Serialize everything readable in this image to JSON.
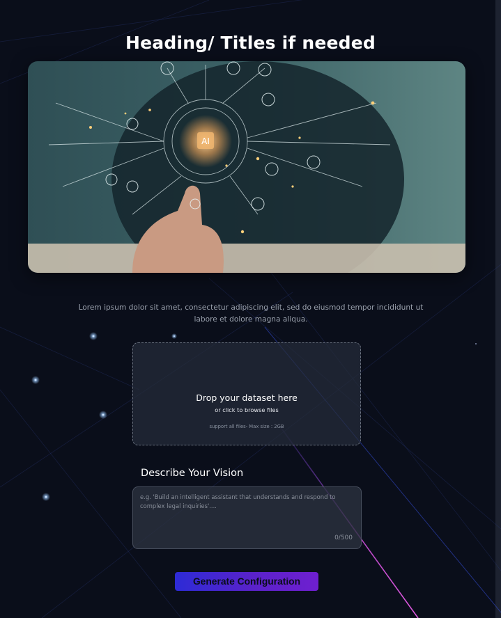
{
  "heading": "Heading/ Titles if needed",
  "hero": {
    "chip_label": "AI",
    "active_slide": 3,
    "dots_count": 5
  },
  "description": "Lorem ipsum dolor sit amet, consectetur adipiscing elit, sed do eiusmod tempor incididunt ut labore et dolore magna aliqua.",
  "dropzone": {
    "title": "Drop your dataset here",
    "subtitle": "or click to browse files",
    "support": "support all files- Max size : 2GB"
  },
  "vision": {
    "label": "Describe Your Vision",
    "placeholder": "e.g. 'Build an intelligent assistant that understands and respond to complex legal inquiries'....",
    "counter": "0/500"
  },
  "generate_button": "Generate Configuration",
  "colors": {
    "background": "#0a0e1a",
    "button_start": "#2d2bd6",
    "button_end": "#6f1fd0",
    "accent_line": "#c84dd6"
  }
}
